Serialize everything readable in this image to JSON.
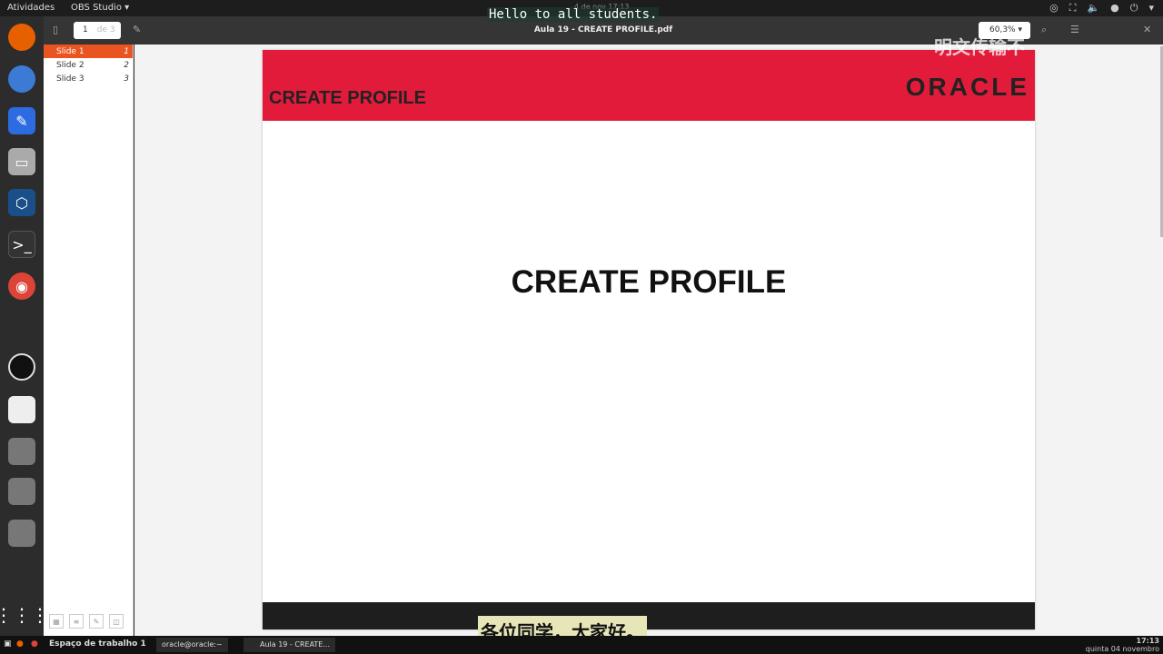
{
  "topbar": {
    "activities": "Atividades",
    "app": "OBS Studio ▾",
    "date": "4 de nov  17:13"
  },
  "toolbar": {
    "page_number": "1",
    "page_total": "de 3",
    "document_title": "Aula 19 - CREATE PROFILE.pdf",
    "zoom": "60,3% ▾"
  },
  "sidebar": {
    "slides": [
      {
        "label": "Slide 1",
        "num": "1"
      },
      {
        "label": "Slide 2",
        "num": "2"
      },
      {
        "label": "Slide 3",
        "num": "3"
      }
    ]
  },
  "slide": {
    "header_title": "CREATE PROFILE",
    "logo": "ORACLE",
    "main_title": "CREATE PROFILE"
  },
  "subtitles": {
    "english": "Hello to all students.",
    "chinese": "各位同学，大家好。"
  },
  "watermark": "明文传输不",
  "taskbar": {
    "workspace": "Espaço de trabalho 1",
    "windows": [
      "oracle@oracle:~",
      "Aula 19 - CREATE..."
    ],
    "time": "17:13",
    "date": "quinta 04 novembro"
  }
}
